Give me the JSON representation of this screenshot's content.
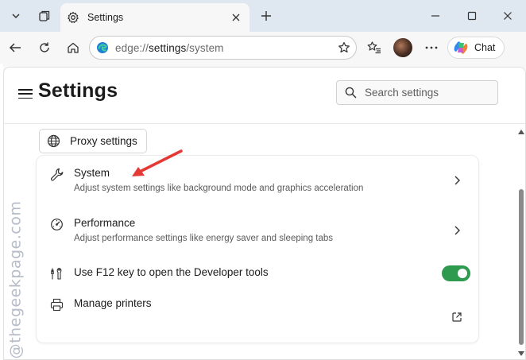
{
  "browser": {
    "tab": {
      "title": "Settings"
    },
    "address_bar": {
      "prefix": "edge://",
      "path": "settings",
      "suffix": "/system"
    },
    "chat_button": {
      "label": "Chat"
    }
  },
  "settings": {
    "title": "Settings",
    "search": {
      "placeholder": "Search settings"
    },
    "proxy_button": {
      "label": "Proxy settings"
    },
    "items": [
      {
        "title": "System",
        "description": "Adjust system settings like background mode and graphics acceleration",
        "icon": "wrench-icon",
        "control": "chevron"
      },
      {
        "title": "Performance",
        "description": "Adjust performance settings like energy saver and sleeping tabs",
        "icon": "performance-gauge-icon",
        "control": "chevron"
      },
      {
        "title": "Use F12 key to open the Developer tools",
        "icon": "developer-tools-icon",
        "control": "toggle",
        "toggle_on": true
      },
      {
        "title": "Manage printers",
        "icon": "printer-icon",
        "control": "external-link"
      }
    ]
  },
  "watermark": {
    "text": "@thegeekpage.com"
  },
  "colors": {
    "toggle_on": "#2e9a4f",
    "annotation_arrow": "#e53935",
    "tabstrip": "#dfe7f0",
    "chrome": "#f7f7f7"
  }
}
